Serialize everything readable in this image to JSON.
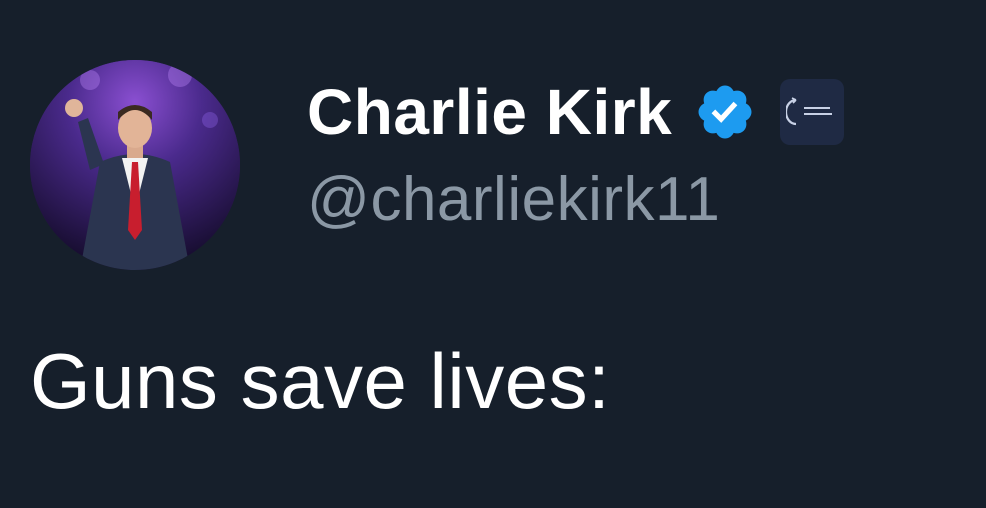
{
  "author": {
    "display_name": "Charlie Kirk",
    "handle": "@charliekirk11",
    "verified": true,
    "verified_badge_color": "#1d9bf0",
    "avatar_icon": "profile-photo",
    "affiliate_badge_icon": "organization-logo"
  },
  "tweet": {
    "text": "Guns save lives:"
  },
  "colors": {
    "background": "#161f2b",
    "text_primary": "#ffffff",
    "text_secondary": "#8b98a5"
  }
}
